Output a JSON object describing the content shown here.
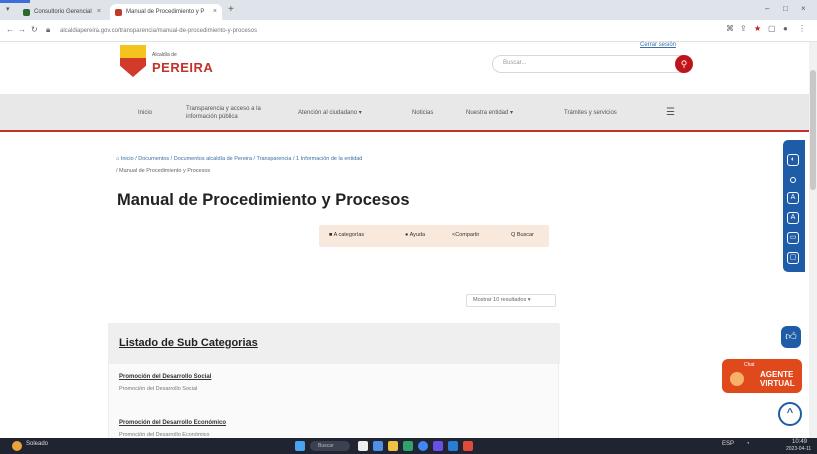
{
  "browser": {
    "tabs": [
      {
        "label": "Consultorio Gerencial"
      },
      {
        "label": "Manual de Procedimiento y P"
      }
    ],
    "new_tab": "+",
    "url": "alcaldiapereira.gov.co/transparencia/manual-de-procedimiento-y-procesos",
    "window_controls": [
      "–",
      "□",
      "×"
    ]
  },
  "header": {
    "logo_small": "Alcaldía de",
    "logo_text": "PEREIRA",
    "logout_link": "Cerrar sesión",
    "search_placeholder": "Buscar..."
  },
  "nav": {
    "items": [
      {
        "label": "Inicio"
      },
      {
        "label": "Transparencia y acceso a la información pública"
      },
      {
        "label": "Atención al ciudadano ▾"
      },
      {
        "label": "Noticias"
      },
      {
        "label": "Nuestra entidad ▾"
      },
      {
        "label": "Trámites y servicios"
      }
    ]
  },
  "breadcrumb": {
    "line1": "⌂ Inicio / Documentos / Documentos alcaldía de Pereira / Transparencia / 1 Información de la entidad",
    "line2": "/ Manual de Procedimiento y Procesos"
  },
  "page_title": "Manual de Procedimiento y Procesos",
  "actions": [
    {
      "icon": "■",
      "label": "A categorías"
    },
    {
      "icon": "●",
      "label": "Ayuda"
    },
    {
      "icon": "<",
      "label": "Compartir"
    },
    {
      "icon": "Q",
      "label": "Buscar"
    }
  ],
  "sort_select": "Mostrar 10 resultados ▾",
  "subcategories": {
    "title": "Listado de Sub Categorias",
    "items": [
      {
        "link": "Promoción del Desarrollo Social",
        "desc": "Promoción del Desarrollo Social"
      },
      {
        "link": "Promoción del Desarrollo Económico",
        "desc": "Promoción del Desarrollo Económico"
      }
    ]
  },
  "widgets": {
    "agent_small": "Chat",
    "agent_line1": "AGENTE",
    "agent_line2": "VIRTUAL",
    "to_top": "^"
  },
  "taskbar": {
    "weather": "Soleado",
    "search": "Buscar",
    "time": "10:49",
    "date": "2023-04-11",
    "lang": "ESP"
  }
}
